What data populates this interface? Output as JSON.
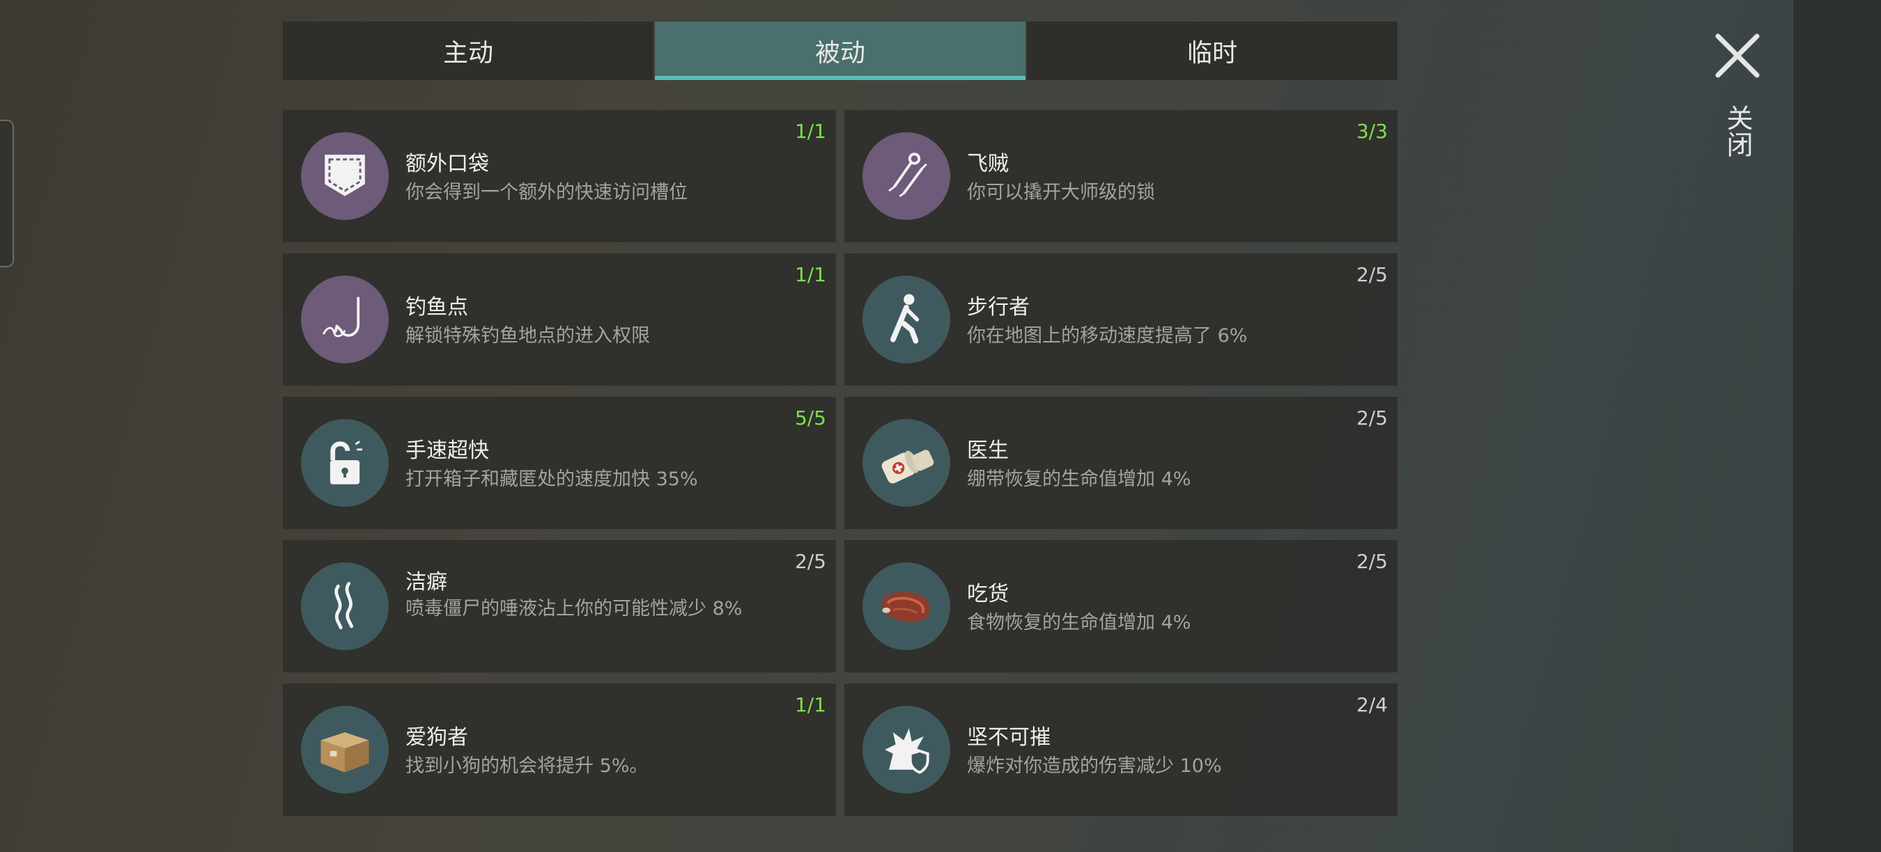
{
  "tabs": [
    {
      "label": "主动"
    },
    {
      "label": "被动"
    },
    {
      "label": "临时"
    }
  ],
  "close": {
    "label": "关闭"
  },
  "skills": [
    {
      "title": "额外口袋",
      "desc": "你会得到一个额外的快速访问槽位",
      "count": "1/1"
    },
    {
      "title": "飞贼",
      "desc": "你可以撬开大师级的锁",
      "count": "3/3"
    },
    {
      "title": "钓鱼点",
      "desc": "解锁特殊钓鱼地点的进入权限",
      "count": "1/1"
    },
    {
      "title": "步行者",
      "desc": "你在地图上的移动速度提高了 6%",
      "count": "2/5"
    },
    {
      "title": "手速超快",
      "desc": "打开箱子和藏匿处的速度加快 35%",
      "count": "5/5"
    },
    {
      "title": "医生",
      "desc": "绷带恢复的生命值增加 4%",
      "count": "2/5"
    },
    {
      "title": "洁癖",
      "desc": "喷毒僵尸的唾液沾上你的可能性减少 8%",
      "count": "2/5"
    },
    {
      "title": "吃货",
      "desc": "食物恢复的生命值增加 4%",
      "count": "2/5"
    },
    {
      "title": "爱狗者",
      "desc": "找到小狗的机会将提升 5%。",
      "count": "1/1"
    },
    {
      "title": "坚不可摧",
      "desc": "爆炸对你造成的伤害减少 10%",
      "count": "2/4"
    }
  ],
  "colors": {
    "maxed": "#7ee04a",
    "partial": "#cfcfcf",
    "tab_active": "#4a6f6c",
    "tab_underline": "#59bcb4"
  },
  "icons": [
    "pocket-icon",
    "lockpick-icon",
    "fishing-hook-icon",
    "walker-icon",
    "unlocked-padlock-icon",
    "bandage-icon",
    "smell-waves-icon",
    "steak-icon",
    "cardboard-box-icon",
    "explosion-shield-icon"
  ]
}
